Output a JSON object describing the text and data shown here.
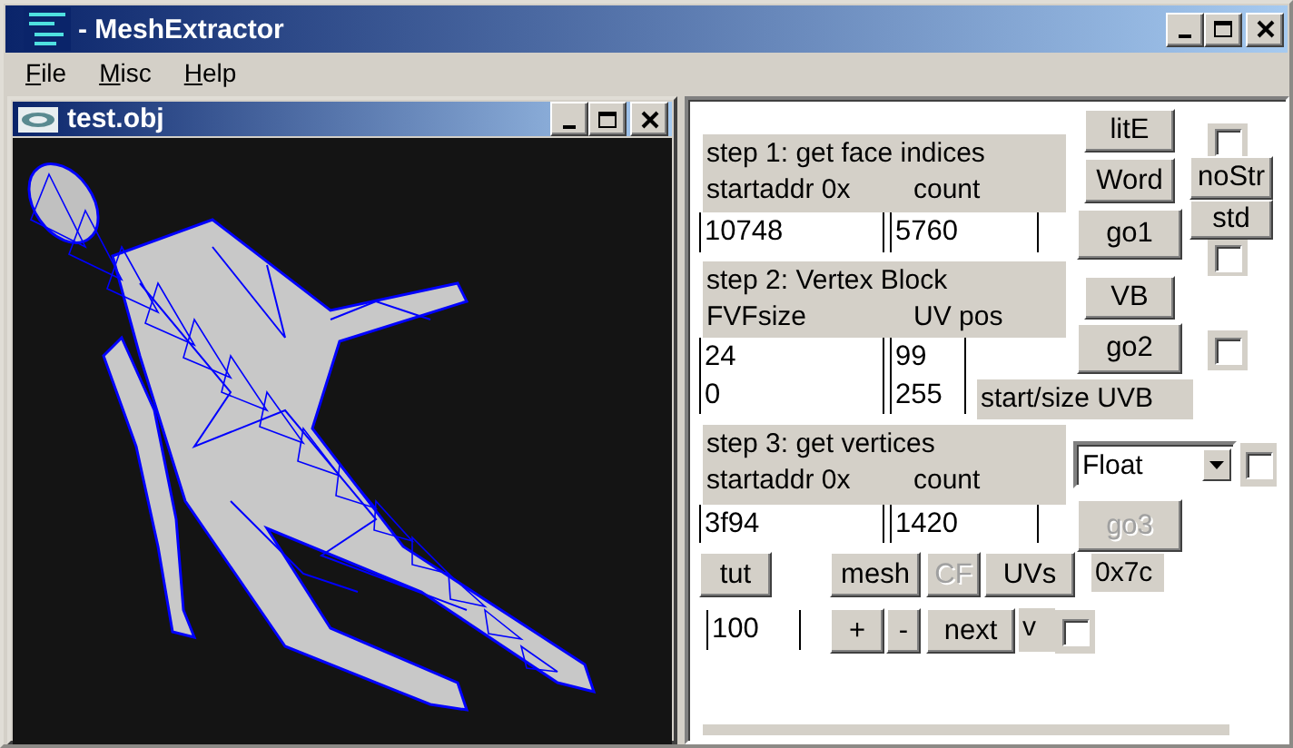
{
  "window": {
    "title": "- MeshExtractor"
  },
  "menu": [
    {
      "label": "File"
    },
    {
      "label": "Misc"
    },
    {
      "label": "Help"
    }
  ],
  "child_window": {
    "title": "test.obj"
  },
  "panel": {
    "controls": [
      {
        "kind": "label",
        "lines": [
          [
            "step 1: get face indices"
          ],
          [
            "startaddr 0x",
            "count"
          ]
        ]
      },
      {
        "kind": "button",
        "label": "litE",
        "disabled": false
      },
      {
        "kind": "checkbox",
        "checked": false
      },
      {
        "kind": "button",
        "label": "Word",
        "disabled": false
      },
      {
        "kind": "button",
        "label": "noStr",
        "disabled": false
      },
      {
        "kind": "field",
        "value": "10748"
      },
      {
        "kind": "field",
        "value": "5760"
      },
      {
        "kind": "button",
        "label": "go1",
        "disabled": false
      },
      {
        "kind": "button",
        "label": "std",
        "disabled": false
      },
      {
        "kind": "checkbox",
        "checked": false
      },
      {
        "kind": "label",
        "lines": [
          [
            "step 2: Vertex Block"
          ],
          [
            "FVFsize",
            "UV pos"
          ]
        ]
      },
      {
        "kind": "button",
        "label": "VB",
        "disabled": false
      },
      {
        "kind": "field",
        "value": "24"
      },
      {
        "kind": "field",
        "value": "99"
      },
      {
        "kind": "button",
        "label": "go2",
        "disabled": false
      },
      {
        "kind": "checkbox",
        "checked": false
      },
      {
        "kind": "field",
        "value": "0"
      },
      {
        "kind": "field",
        "value": "255"
      },
      {
        "kind": "label",
        "lines": [
          [
            "start/size UVB"
          ]
        ]
      },
      {
        "kind": "label",
        "lines": [
          [
            "step 3: get vertices"
          ],
          [
            "startaddr 0x",
            "count"
          ]
        ]
      },
      {
        "kind": "dropdown",
        "value": "Float"
      },
      {
        "kind": "checkbox",
        "checked": false
      },
      {
        "kind": "field",
        "value": "3f94"
      },
      {
        "kind": "field",
        "value": "1420"
      },
      {
        "kind": "button",
        "label": "go3",
        "disabled": true
      },
      {
        "kind": "button",
        "label": "tut",
        "disabled": false
      },
      {
        "kind": "button",
        "label": "mesh",
        "disabled": false
      },
      {
        "kind": "button",
        "label": "CF",
        "disabled": true
      },
      {
        "kind": "button",
        "label": "UVs",
        "disabled": false
      },
      {
        "kind": "label",
        "lines": [
          [
            "0x7c"
          ]
        ]
      },
      {
        "kind": "field",
        "value": "100"
      },
      {
        "kind": "button",
        "label": "+",
        "disabled": false
      },
      {
        "kind": "button",
        "label": "-",
        "disabled": false
      },
      {
        "kind": "button",
        "label": "next",
        "disabled": false
      },
      {
        "kind": "label",
        "lines": [
          [
            "v"
          ]
        ]
      },
      {
        "kind": "checkbox",
        "checked": false
      }
    ]
  }
}
